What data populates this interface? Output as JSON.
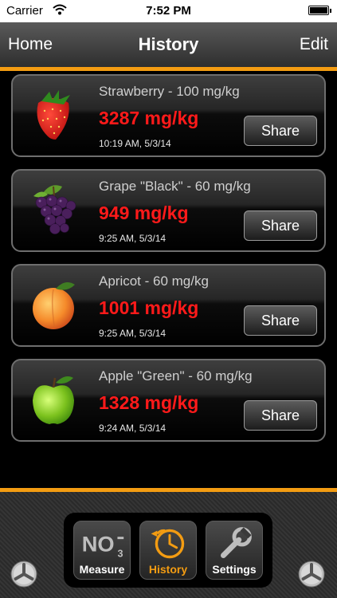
{
  "status": {
    "carrier": "Carrier",
    "time": "7:52 PM"
  },
  "nav": {
    "left": "Home",
    "title": "History",
    "right": "Edit"
  },
  "entries": [
    {
      "name": "Strawberry - 100 mg/kg",
      "value": "3287 mg/kg",
      "timestamp": "10:19 AM, 5/3/14",
      "share": "Share",
      "icon": "strawberry-icon"
    },
    {
      "name": "Grape \"Black\" - 60 mg/kg",
      "value": "949 mg/kg",
      "timestamp": "9:25 AM, 5/3/14",
      "share": "Share",
      "icon": "grape-icon"
    },
    {
      "name": "Apricot - 60 mg/kg",
      "value": "1001 mg/kg",
      "timestamp": "9:25 AM, 5/3/14",
      "share": "Share",
      "icon": "apricot-icon"
    },
    {
      "name": "Apple \"Green\" - 60 mg/kg",
      "value": "1328 mg/kg",
      "timestamp": "9:24 AM, 5/3/14",
      "share": "Share",
      "icon": "green-apple-icon"
    }
  ],
  "tabs": [
    {
      "label": "Measure",
      "icon": "no3-icon",
      "active": false
    },
    {
      "label": "History",
      "icon": "history-clock-icon",
      "active": true
    },
    {
      "label": "Settings",
      "icon": "wrench-icon",
      "active": false
    }
  ],
  "colors": {
    "accent": "#f39c12",
    "value_red": "#ff1a1a"
  }
}
